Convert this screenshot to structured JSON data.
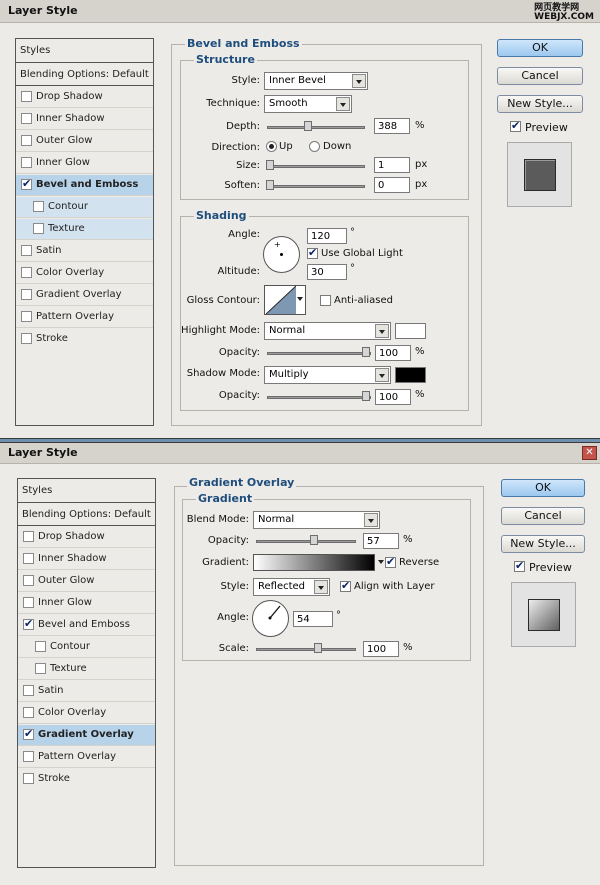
{
  "d1": {
    "title": "Layer Style",
    "watermark": "网页教学网\nWEBJX.COM",
    "styles_header": "Styles",
    "blending": "Blending Options: Default",
    "items": [
      "Drop Shadow",
      "Inner Shadow",
      "Outer Glow",
      "Inner Glow",
      "Bevel and Emboss",
      "Contour",
      "Texture",
      "Satin",
      "Color Overlay",
      "Gradient Overlay",
      "Pattern Overlay",
      "Stroke"
    ],
    "section_title": "Bevel and Emboss",
    "structure": {
      "title": "Structure",
      "style_label": "Style:",
      "style_value": "Inner Bevel",
      "technique_label": "Technique:",
      "technique_value": "Smooth",
      "depth_label": "Depth:",
      "depth_value": "388",
      "depth_unit": "%",
      "direction_label": "Direction:",
      "up": "Up",
      "down": "Down",
      "size_label": "Size:",
      "size_value": "1",
      "size_unit": "px",
      "soften_label": "Soften:",
      "soften_value": "0",
      "soften_unit": "px"
    },
    "shading": {
      "title": "Shading",
      "angle_label": "Angle:",
      "angle_value": "120",
      "degree": "°",
      "global_light": "Use Global Light",
      "altitude_label": "Altitude:",
      "altitude_value": "30",
      "gloss_label": "Gloss Contour:",
      "anti_aliased": "Anti-aliased",
      "highlight_label": "Highlight Mode:",
      "highlight_value": "Normal",
      "opacity_label": "Opacity:",
      "highlight_opacity": "100",
      "pct": "%",
      "shadow_label": "Shadow Mode:",
      "shadow_value": "Multiply",
      "shadow_opacity": "100"
    },
    "buttons": {
      "ok": "OK",
      "cancel": "Cancel",
      "new_style": "New Style...",
      "preview": "Preview"
    }
  },
  "d2": {
    "title": "Layer Style",
    "styles_header": "Styles",
    "blending": "Blending Options: Default",
    "items": [
      "Drop Shadow",
      "Inner Shadow",
      "Outer Glow",
      "Inner Glow",
      "Bevel and Emboss",
      "Contour",
      "Texture",
      "Satin",
      "Color Overlay",
      "Gradient Overlay",
      "Pattern Overlay",
      "Stroke"
    ],
    "section_title": "Gradient Overlay",
    "gradient": {
      "title": "Gradient",
      "blend_label": "Blend Mode:",
      "blend_value": "Normal",
      "opacity_label": "Opacity:",
      "opacity_value": "57",
      "pct": "%",
      "gradient_label": "Gradient:",
      "reverse": "Reverse",
      "style_label": "Style:",
      "style_value": "Reflected",
      "align": "Align with Layer",
      "angle_label": "Angle:",
      "angle_value": "54",
      "degree": "°",
      "scale_label": "Scale:",
      "scale_value": "100"
    },
    "buttons": {
      "ok": "OK",
      "cancel": "Cancel",
      "new_style": "New Style...",
      "preview": "Preview"
    }
  }
}
